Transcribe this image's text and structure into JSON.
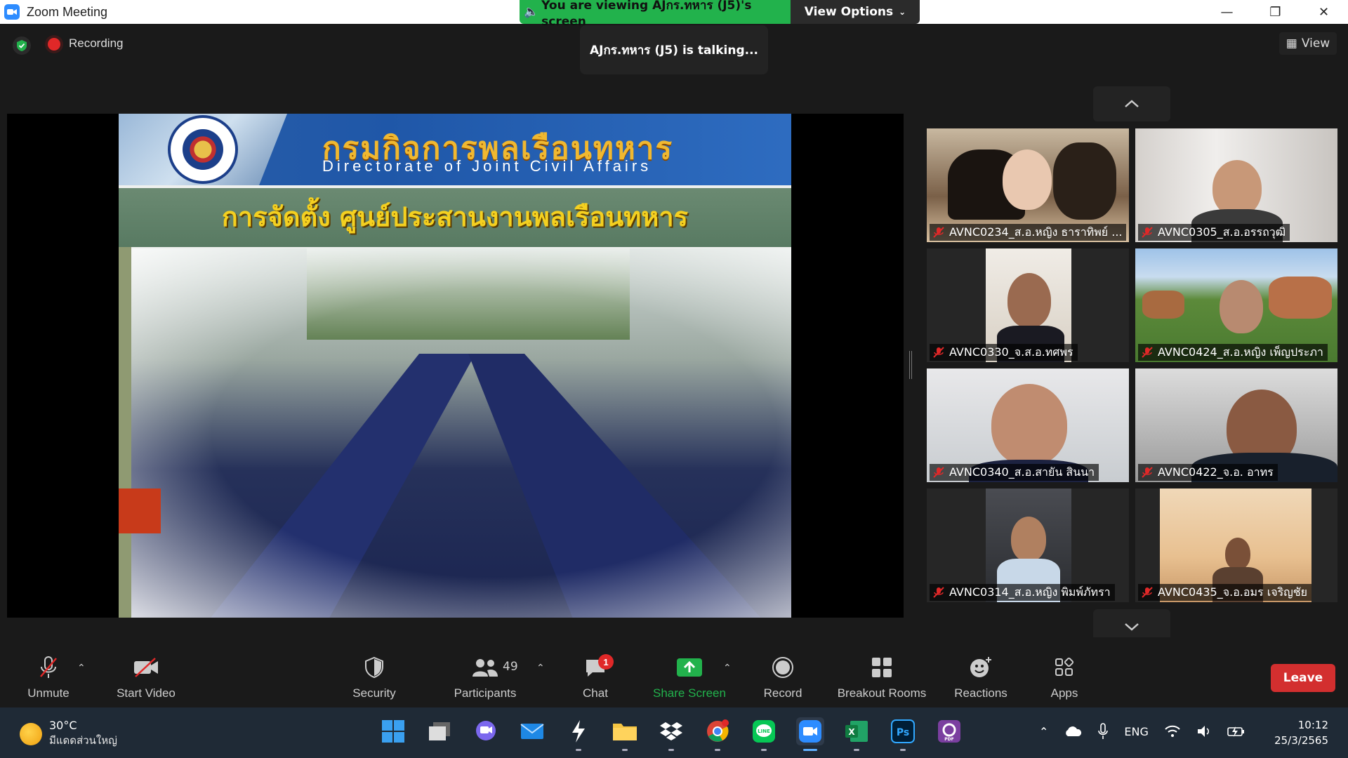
{
  "window": {
    "title": "Zoom Meeting"
  },
  "share_banner": {
    "text": "You are viewing AJกร.ทหาร (J5)'s screen",
    "view_options": "View Options"
  },
  "meeting": {
    "recording_label": "Recording",
    "talking": "AJกร.ทหาร (J5)  is talking...",
    "view_label": "View"
  },
  "slide": {
    "title_th": "กรมกิจการพลเรือนทหาร",
    "title_en": "Directorate  of  Joint  Civil  Affairs",
    "subtitle": "การจัดตั้ง ศูนย์ประสานงานพลเรือนทหาร"
  },
  "gallery": {
    "tiles": [
      {
        "name": "AVNC0234_ส.อ.หญิง ธาราทิพย์ ..."
      },
      {
        "name": "AVNC0305_ส.อ.อรรถวุฒิ"
      },
      {
        "name": "AVNC0330_จ.ส.อ.ทศพร"
      },
      {
        "name": "AVNC0424_ส.อ.หญิง เพ็ญประภา"
      },
      {
        "name": "AVNC0340_ส.อ.สายัน สินนา"
      },
      {
        "name": "AVNC0422_จ.อ. อาทร"
      },
      {
        "name": "AVNC0314_ส.อ.หญิง พิมพ์ภัทรา"
      },
      {
        "name": "AVNC0435_จ.อ.อมร  เจริญชัย"
      }
    ]
  },
  "toolbar": {
    "unmute": "Unmute",
    "start_video": "Start Video",
    "security": "Security",
    "participants": "Participants",
    "participants_count": "49",
    "chat": "Chat",
    "chat_badge": "1",
    "share_screen": "Share Screen",
    "record": "Record",
    "breakout": "Breakout Rooms",
    "reactions": "Reactions",
    "apps": "Apps",
    "leave": "Leave"
  },
  "taskbar": {
    "temperature": "30°C",
    "condition": "มีแดดส่วนใหญ่",
    "language": "ENG",
    "time": "10:12",
    "date": "25/3/2565"
  },
  "colors": {
    "accent": "#2d8cff",
    "banner": "#22b24c",
    "leave": "#d32f2f",
    "share": "#22b24c",
    "mic_muted": "#e02828"
  }
}
